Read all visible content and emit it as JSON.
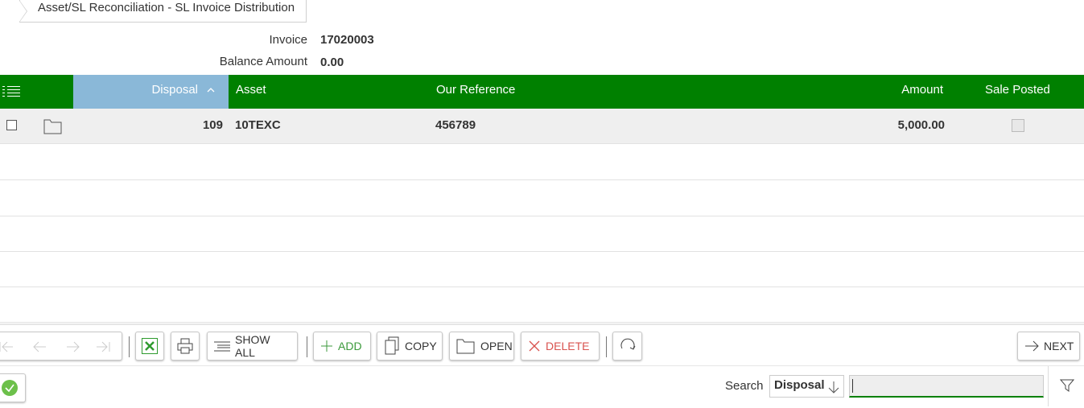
{
  "breadcrumb": {
    "title": "Asset/SL Reconciliation - SL Invoice Distribution"
  },
  "header_fields": {
    "invoice_label": "Invoice",
    "invoice_value": "17020003",
    "balance_label": "Balance Amount",
    "balance_value": "0.00"
  },
  "grid": {
    "columns": {
      "disposal": "Disposal",
      "asset": "Asset",
      "our_reference": "Our Reference",
      "amount": "Amount",
      "sale_posted": "Sale Posted"
    },
    "sort": {
      "column": "disposal",
      "direction": "ascending"
    },
    "rows": [
      {
        "disposal": "109",
        "asset": "10TEXC",
        "our_reference": "456789",
        "amount": "5,000.00",
        "sale_posted": false
      }
    ]
  },
  "toolbar": {
    "show_all_label": "SHOW ALL",
    "add_label": "ADD",
    "copy_label": "COPY",
    "open_label": "OPEN",
    "delete_label": "DELETE",
    "next_label": "NEXT"
  },
  "search": {
    "label": "Search",
    "field_selected": "Disposal",
    "value": ""
  },
  "colors": {
    "header_green": "#008000",
    "sorted_column": "#8ab8d8",
    "excel_green": "#2e9b2e",
    "delete_red": "#d9534f",
    "add_green": "#3c9a3c",
    "status_ok": "#6cc04a"
  }
}
